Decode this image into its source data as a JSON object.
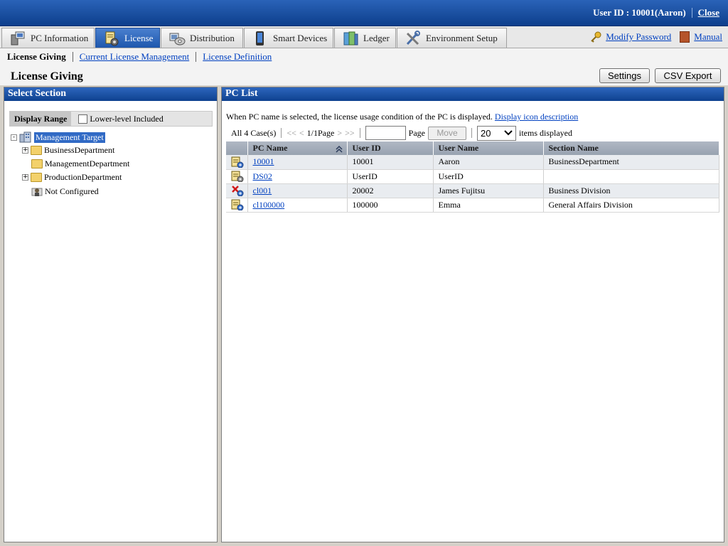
{
  "header": {
    "user_id": "User ID : 10001(Aaron)",
    "close_label": "Close"
  },
  "tabs": [
    {
      "label": "PC Information",
      "active": false
    },
    {
      "label": "License",
      "active": true
    },
    {
      "label": "Distribution",
      "active": false
    },
    {
      "label": "Smart Devices",
      "active": false
    },
    {
      "label": "Ledger",
      "active": false
    },
    {
      "label": "Environment Setup",
      "active": false
    }
  ],
  "tab_links": {
    "modify_password": "Modify Password",
    "manual": "Manual"
  },
  "subnav": {
    "current": "License Giving",
    "link1": "Current License Management",
    "link2": "License Definition"
  },
  "page": {
    "title": "License Giving",
    "settings_label": "Settings",
    "csv_label": "CSV Export"
  },
  "left": {
    "title": "Select Section",
    "display_range": "Display Range",
    "lower_level": "Lower-level Included",
    "tree": [
      {
        "label": "Management Target",
        "level": 0,
        "expander": "-"
      },
      {
        "label": "BusinessDepartment",
        "level": 1,
        "expander": "+"
      },
      {
        "label": "ManagementDepartment",
        "level": 1,
        "expander": ""
      },
      {
        "label": "ProductionDepartment",
        "level": 1,
        "expander": "+"
      },
      {
        "label": "Not Configured",
        "level": 1,
        "expander": ""
      }
    ]
  },
  "right": {
    "title": "PC List",
    "desc": "When PC name is selected, the license usage condition of the PC is displayed.",
    "desc_link": "Display icon description",
    "pager": {
      "count": "All 4 Case(s)",
      "first": "<<",
      "prev": "<",
      "page": "1/1Page",
      "next": ">",
      "last": ">>",
      "page_label": "Page",
      "move_label": "Move",
      "per_page": "20",
      "items_label": "items displayed"
    },
    "columns": [
      "PC Name",
      "User ID",
      "User Name",
      "Section Name"
    ],
    "rows": [
      {
        "pc": "10001",
        "user_id": "10001",
        "user_name": "Aaron",
        "section": "BusinessDepartment",
        "icon": "pc-license-icon"
      },
      {
        "pc": "DS02",
        "user_id": "UserID",
        "user_name": "UserID",
        "section": "",
        "icon": "pc-settings-icon"
      },
      {
        "pc": "cl001",
        "user_id": "20002",
        "user_name": "James Fujitsu",
        "section": "Business Division",
        "icon": "pc-error-icon"
      },
      {
        "pc": "cl100000",
        "user_id": "100000",
        "user_name": "Emma",
        "section": "General Affairs Division",
        "icon": "pc-license-icon"
      }
    ]
  },
  "colors": {
    "header_blue": "#0d3f8c",
    "tab_active": "#1e57ad",
    "link": "#0040c0",
    "selected": "#316ac5"
  }
}
